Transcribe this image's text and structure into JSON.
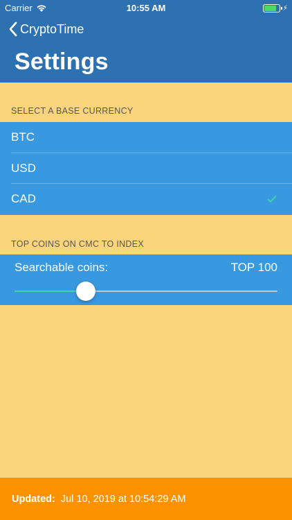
{
  "status_bar": {
    "carrier": "Carrier",
    "time": "10:55 AM",
    "battery_level": 0.75
  },
  "nav": {
    "back_label": "CryptoTime",
    "title": "Settings"
  },
  "currency_section": {
    "header": "SELECT A BASE CURRENCY",
    "items": [
      {
        "label": "BTC",
        "selected": false
      },
      {
        "label": "USD",
        "selected": false
      },
      {
        "label": "CAD",
        "selected": true
      }
    ]
  },
  "coins_section": {
    "header": "TOP COINS ON CMC TO INDEX",
    "label": "Searchable coins:",
    "value": "TOP 100",
    "slider_fraction": 0.27
  },
  "footer": {
    "label": "Updated:",
    "timestamp": "Jul 10, 2019 at 10:54:29 AM"
  },
  "colors": {
    "background": "#FDD47E",
    "header": "#2E71B0",
    "row": "#3898E0",
    "accent": "#3DD8A0",
    "footer": "#FB9300"
  }
}
